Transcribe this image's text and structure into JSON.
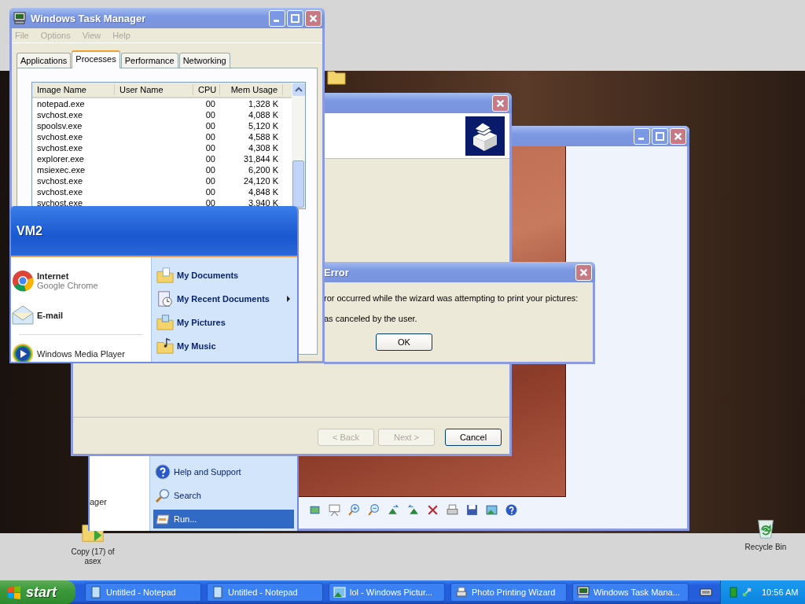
{
  "desktop": {
    "icons": [
      {
        "kind": "folder",
        "label": "Copy (17) of asex"
      },
      {
        "kind": "recycle",
        "label": "Recycle Bin"
      }
    ]
  },
  "photo_printing_wizard": {
    "buttons": [
      {
        "label": "< Back",
        "disabled": true
      },
      {
        "label": "Next >",
        "disabled": true
      },
      {
        "label": "Cancel",
        "disabled": false
      }
    ]
  },
  "error_dialog": {
    "title": "Error",
    "message": "ror occurred while the wizard was attempting to print your pictures:",
    "detail": "as canceled by the user.",
    "button": "OK"
  },
  "task_manager": {
    "title": "Windows Task Manager",
    "menu": [
      "File",
      "Options",
      "View",
      "Help"
    ],
    "tabs": [
      {
        "label": "Applications",
        "selected": false
      },
      {
        "label": "Processes",
        "selected": true
      },
      {
        "label": "Performance",
        "selected": false
      },
      {
        "label": "Networking",
        "selected": false
      }
    ],
    "columns": [
      "Image Name",
      "User Name",
      "CPU",
      "Mem Usage"
    ],
    "rows": [
      {
        "image_name": "notepad.exe",
        "cpu": "00",
        "mem_usage": "1,328 K"
      },
      {
        "image_name": "svchost.exe",
        "cpu": "00",
        "mem_usage": "4,088 K"
      },
      {
        "image_name": "spoolsv.exe",
        "cpu": "00",
        "mem_usage": "5,120 K"
      },
      {
        "image_name": "svchost.exe",
        "cpu": "00",
        "mem_usage": "4,588 K"
      },
      {
        "image_name": "svchost.exe",
        "cpu": "00",
        "mem_usage": "4,308 K"
      },
      {
        "image_name": "explorer.exe",
        "cpu": "00",
        "mem_usage": "31,844 K"
      },
      {
        "image_name": "msiexec.exe",
        "cpu": "00",
        "mem_usage": "6,200 K"
      },
      {
        "image_name": "svchost.exe",
        "cpu": "00",
        "mem_usage": "24,120 K"
      },
      {
        "image_name": "svchost.exe",
        "cpu": "00",
        "mem_usage": "4,848 K"
      },
      {
        "image_name": "svchost.exe",
        "cpu": "00",
        "mem_usage": "3,940 K"
      }
    ]
  },
  "start_menu": {
    "user": "VM2",
    "pinned": [
      {
        "kind": "browser",
        "title": "Internet",
        "subtitle": "Google Chrome"
      },
      {
        "kind": "mail",
        "title": "E-mail"
      }
    ],
    "recent": [
      {
        "kind": "media",
        "title": "Windows Media Player"
      }
    ],
    "recent_partial": "ager",
    "places": [
      {
        "kind": "documents",
        "label": "My Documents",
        "submenu": false
      },
      {
        "kind": "recent",
        "label": "My Recent Documents",
        "submenu": true
      },
      {
        "kind": "pictures",
        "label": "My Pictures",
        "submenu": false
      },
      {
        "kind": "music",
        "label": "My Music",
        "submenu": false
      }
    ],
    "system": [
      {
        "kind": "help",
        "label": "Help and Support",
        "selected": false
      },
      {
        "kind": "search",
        "label": "Search",
        "selected": false
      },
      {
        "kind": "run",
        "label": "Run...",
        "selected": true
      }
    ]
  },
  "taskbar": {
    "start": "start",
    "buttons": [
      {
        "kind": "notepad",
        "label": "Untitled - Notepad"
      },
      {
        "kind": "notepad",
        "label": "Untitled - Notepad"
      },
      {
        "kind": "picture",
        "label": "lol - Windows Pictur..."
      },
      {
        "kind": "wizard",
        "label": "Photo Printing Wizard"
      },
      {
        "kind": "taskmgr",
        "label": "Windows Task Mana..."
      }
    ],
    "clock": "10:56 AM"
  }
}
